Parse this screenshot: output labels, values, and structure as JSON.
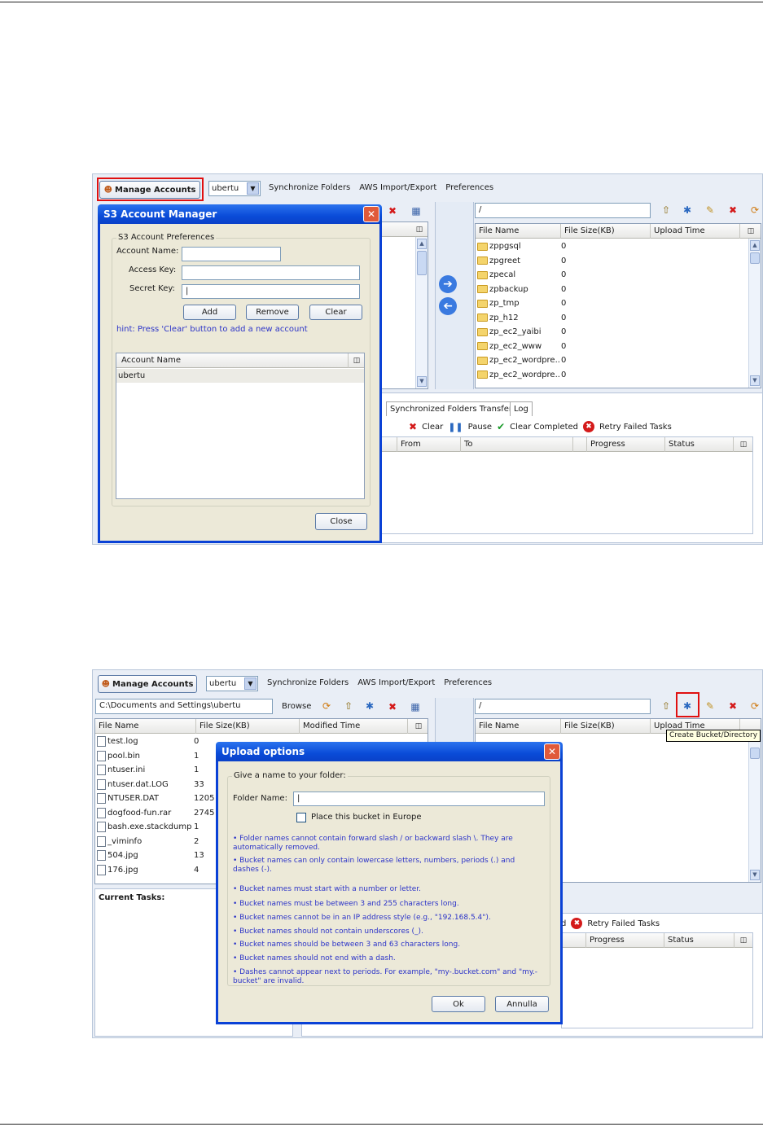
{
  "shot1": {
    "menu": {
      "manage_accounts": "Manage Accounts",
      "account_select": "ubertu",
      "sync_folders": "Synchronize Folders",
      "aws_import_export": "AWS Import/Export",
      "preferences": "Preferences"
    },
    "remote_path": "/",
    "remote_columns": [
      "File Name",
      "File Size(KB)",
      "Upload Time"
    ],
    "remote_rows": [
      {
        "name": "zppgsql",
        "size": "0"
      },
      {
        "name": "zpgreet",
        "size": "0"
      },
      {
        "name": "zpecal",
        "size": "0"
      },
      {
        "name": "zpbackup",
        "size": "0"
      },
      {
        "name": "zp_tmp",
        "size": "0"
      },
      {
        "name": "zp_h12",
        "size": "0"
      },
      {
        "name": "zp_ec2_yaibi",
        "size": "0"
      },
      {
        "name": "zp_ec2_www",
        "size": "0"
      },
      {
        "name": "zp_ec2_wordpre...",
        "size": "0"
      },
      {
        "name": "zp_ec2_wordpre...",
        "size": "0"
      }
    ],
    "tasks": {
      "tab_sync": "Synchronized Folders Transfer",
      "tab_log": "Log",
      "clear": "Clear",
      "pause": "Pause",
      "clear_completed": "Clear Completed",
      "retry_failed": "Retry Failed Tasks",
      "columns": [
        "From",
        "To",
        "Progress",
        "Status"
      ]
    },
    "dialog": {
      "title": "S3 Account Manager",
      "group_label": "S3 Account Preferences",
      "account_name_label": "Account Name:",
      "access_key_label": "Access Key:",
      "secret_key_label": "Secret Key:",
      "add": "Add",
      "remove": "Remove",
      "clear": "Clear",
      "hint": "hint: Press 'Clear' button to add a new account",
      "list_header": "Account Name",
      "accounts": [
        "ubertu"
      ],
      "close": "Close"
    }
  },
  "shot2": {
    "menu": {
      "manage_accounts": "Manage Accounts",
      "account_select": "ubertu",
      "sync_folders": "Synchronize Folders",
      "aws_import_export": "AWS Import/Export",
      "preferences": "Preferences"
    },
    "local_path": "C:\\Documents and Settings\\ubertu",
    "browse": "Browse",
    "remote_path": "/",
    "local_columns": [
      "File Name",
      "File Size(KB)",
      "Modified Time"
    ],
    "remote_columns": [
      "File Name",
      "File Size(KB)",
      "Upload Time"
    ],
    "local_rows": [
      {
        "name": "test.log",
        "size": "0"
      },
      {
        "name": "pool.bin",
        "size": "1"
      },
      {
        "name": "ntuser.ini",
        "size": "1"
      },
      {
        "name": "ntuser.dat.LOG",
        "size": "33"
      },
      {
        "name": "NTUSER.DAT",
        "size": "1205"
      },
      {
        "name": "dogfood-fun.rar",
        "size": "2745"
      },
      {
        "name": "bash.exe.stackdump",
        "size": "1"
      },
      {
        "name": "_viminfo",
        "size": "2"
      },
      {
        "name": "504.jpg",
        "size": "13"
      },
      {
        "name": "176.jpg",
        "size": "4"
      }
    ],
    "current_tasks": "Current Tasks:",
    "retry_suffix": "d",
    "retry_failed": "Retry Failed Tasks",
    "task_columns": [
      "Progress",
      "Status"
    ],
    "tooltip": "Create Bucket/Directory",
    "dialog": {
      "title": "Upload options",
      "group_label": "Give a name to your folder:",
      "folder_name_label": "Folder Name:",
      "europe_label": "Place this bucket in Europe",
      "rules": [
        "• Folder names cannot contain forward slash / or backward slash \\. They are automatically removed.",
        "• Bucket names can only contain lowercase letters, numbers, periods (.) and dashes (-).",
        "• Bucket names must start with a number or letter.",
        "• Bucket names must be between 3 and 255 characters long.",
        "• Bucket names cannot be in an IP address style (e.g., \"192.168.5.4\").",
        "• Bucket names should not contain underscores (_).",
        "• Bucket names should be between 3 and 63 characters long.",
        "• Bucket names should not end with a dash.",
        "• Dashes cannot appear next to periods. For example, \"my-.bucket.com\" and \"my.-bucket\" are invalid."
      ],
      "ok": "Ok",
      "cancel": "Annulla"
    }
  },
  "colors": {
    "highlight_red": "#e01010",
    "dialog_title_blue": "#0a4bd8",
    "hint_blue": "#2c34c8"
  }
}
